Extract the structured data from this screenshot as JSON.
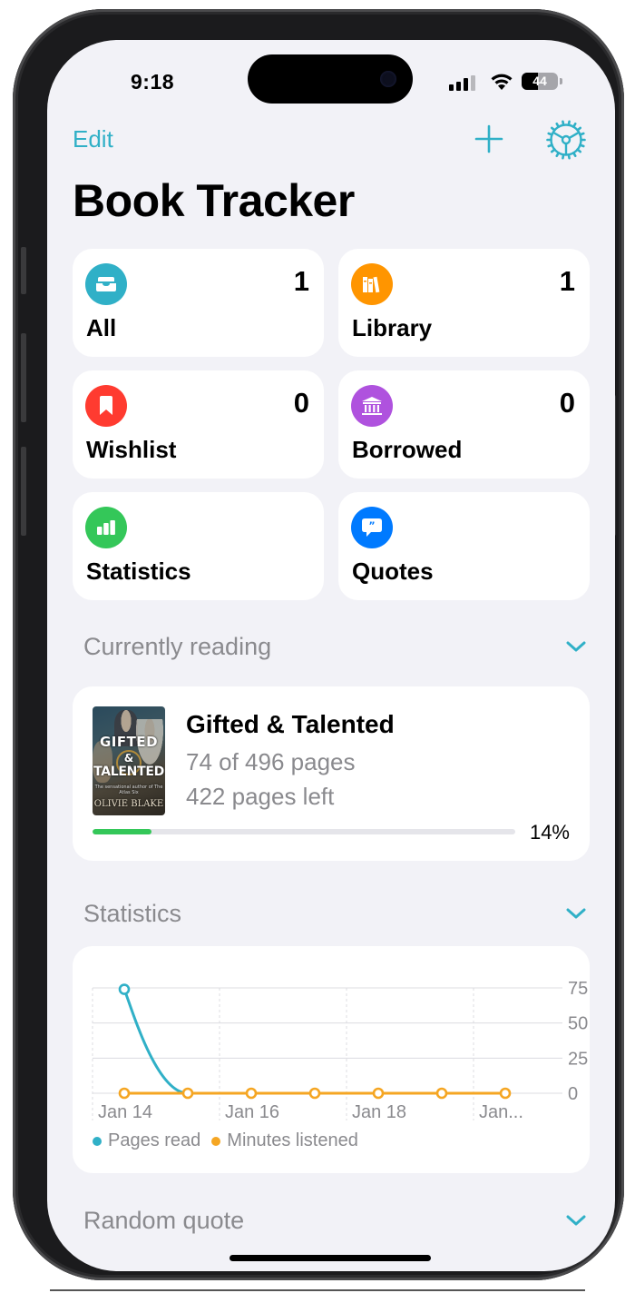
{
  "status_bar": {
    "time": "9:18",
    "battery_level": "44",
    "battery_fraction": 0.44,
    "signal_bars_active": 3,
    "signal_bars_total": 4
  },
  "nav": {
    "edit_label": "Edit",
    "add_icon": "plus-icon",
    "settings_icon": "gear-icon"
  },
  "page": {
    "title": "Book Tracker"
  },
  "colors": {
    "accent": "#30b0c7",
    "background": "#f2f2f7",
    "card": "#ffffff",
    "secondary_text": "#8a8a8e",
    "progress_fill": "#34c759"
  },
  "tiles": [
    {
      "label": "All",
      "count": "1",
      "icon": "tray-icon",
      "color": "#30b0c7"
    },
    {
      "label": "Library",
      "count": "1",
      "icon": "books-icon",
      "color": "#ff9500"
    },
    {
      "label": "Wishlist",
      "count": "0",
      "icon": "bookmark-icon",
      "color": "#ff3b30"
    },
    {
      "label": "Borrowed",
      "count": "0",
      "icon": "building-columns-icon",
      "color": "#af52de"
    },
    {
      "label": "Statistics",
      "count": "",
      "icon": "chart-bar-icon",
      "color": "#34c759"
    },
    {
      "label": "Quotes",
      "count": "",
      "icon": "quote-bubble-icon",
      "color": "#007aff"
    }
  ],
  "sections": {
    "currently_reading": "Currently reading",
    "statistics": "Statistics",
    "random_quote": "Random quote"
  },
  "current_book": {
    "title": "Gifted & Talented",
    "progress_text": "74 of 496 pages",
    "left_text": "422 pages left",
    "percent_label": "14%",
    "progress_fraction": 0.14,
    "cover": {
      "line1": "GIFTED",
      "line2": "&",
      "line3": "TALENTED",
      "tagline": "The sensational author of The Atlas Six",
      "author": "OLIVIE BLAKE"
    }
  },
  "chart_data": {
    "type": "line",
    "x": [
      "Jan 14",
      "Jan 15",
      "Jan 16",
      "Jan 17",
      "Jan 18",
      "Jan 19",
      "Jan 20"
    ],
    "x_tick_labels": [
      "Jan 14",
      "Jan 16",
      "Jan 18",
      "Jan..."
    ],
    "series": [
      {
        "name": "Pages read",
        "color": "#30b0c7",
        "values": [
          74,
          0,
          null,
          null,
          null,
          null,
          null
        ]
      },
      {
        "name": "Minutes listened",
        "color": "#f5a623",
        "values": [
          0,
          0,
          0,
          0,
          0,
          0,
          0
        ]
      }
    ],
    "y_ticks": [
      0,
      25,
      50,
      75
    ],
    "ylim": [
      0,
      75
    ],
    "y_axis_side": "right",
    "grid": true,
    "legend_position": "bottom-left",
    "title": "",
    "xlabel": "",
    "ylabel": ""
  }
}
